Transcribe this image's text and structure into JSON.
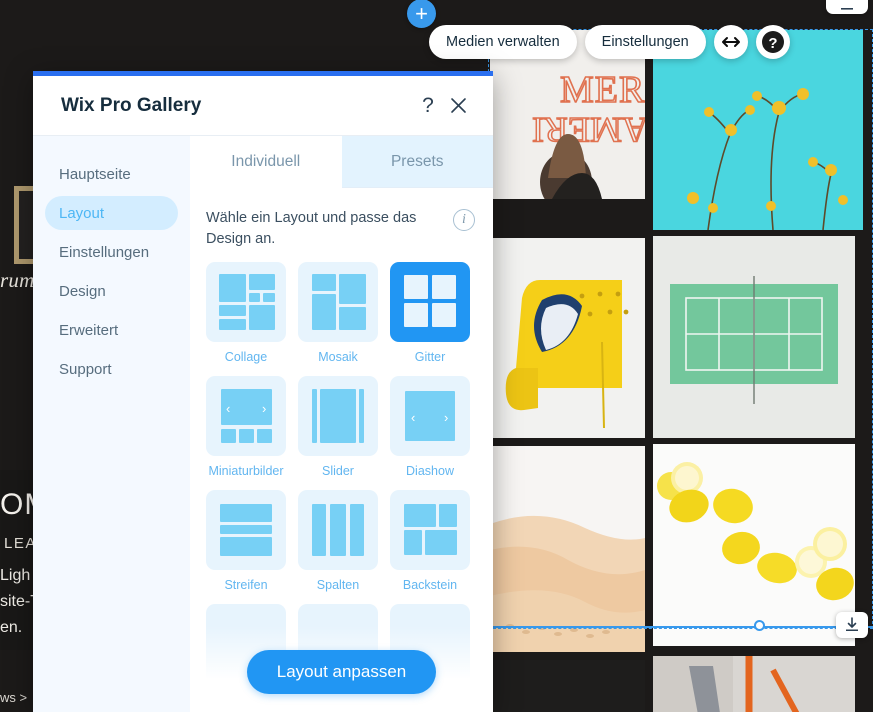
{
  "editor": {
    "add_button_label": "+",
    "toolbar": {
      "manage_media_label": "Medien verwalten",
      "settings_label": "Einstellungen",
      "stretch_icon": "arrows-horizontal-icon",
      "help_icon": "question-mark-circle-icon"
    },
    "top_right_button_icon": "minimize-icon",
    "download_button_icon": "download-icon",
    "left_site_text": {
      "word": "rum",
      "heading": "OM",
      "subheading": "LEAN",
      "line1": "Ligh",
      "line2": "site-T",
      "line3": "en.",
      "footer": "ws >"
    },
    "gallery_tiles": [
      {
        "name": "neon-america-sign-photo"
      },
      {
        "name": "yellow-flowers-teal-sky-photo"
      },
      {
        "name": "yellow-sofa-photo"
      },
      {
        "name": "green-tennis-court-photo"
      },
      {
        "name": "desert-dunes-photo"
      },
      {
        "name": "lemons-on-white-photo"
      },
      {
        "name": "dark-photo"
      },
      {
        "name": "bicycle-photo"
      }
    ]
  },
  "modal": {
    "title": "Wix Pro Gallery",
    "help_icon": "question-mark-icon",
    "close_icon": "close-x-icon",
    "sidebar": {
      "items": [
        {
          "label": "Hauptseite",
          "active": false
        },
        {
          "label": "Layout",
          "active": true
        },
        {
          "label": "Einstellungen",
          "active": false
        },
        {
          "label": "Design",
          "active": false
        },
        {
          "label": "Erweitert",
          "active": false
        },
        {
          "label": "Support",
          "active": false
        }
      ]
    },
    "tabs": [
      {
        "label": "Individuell",
        "active": true
      },
      {
        "label": "Presets",
        "active": false
      }
    ],
    "intro_text": "Wähle ein Layout und passe das Design an.",
    "info_icon": "info-circle-icon",
    "layouts": [
      {
        "label": "Collage",
        "selected": false,
        "pattern": "collage"
      },
      {
        "label": "Mosaik",
        "selected": false,
        "pattern": "mosaik"
      },
      {
        "label": "Gitter",
        "selected": true,
        "pattern": "gitter"
      },
      {
        "label": "Miniaturbilder",
        "selected": false,
        "pattern": "thumbs"
      },
      {
        "label": "Slider",
        "selected": false,
        "pattern": "slider"
      },
      {
        "label": "Diashow",
        "selected": false,
        "pattern": "diashow"
      },
      {
        "label": "Streifen",
        "selected": false,
        "pattern": "streifen"
      },
      {
        "label": "Spalten",
        "selected": false,
        "pattern": "spalten"
      },
      {
        "label": "Backstein",
        "selected": false,
        "pattern": "backstein"
      },
      {
        "label": "",
        "selected": false,
        "pattern": "empty"
      },
      {
        "label": "",
        "selected": false,
        "pattern": "empty"
      },
      {
        "label": "",
        "selected": false,
        "pattern": "empty"
      }
    ],
    "cta_label": "Layout anpassen"
  },
  "colors": {
    "accent": "#2196f3",
    "thumb_bg": "#e7f4fd",
    "thumb_block": "#77d0f5",
    "sidebar_bg": "#f4f9ff",
    "label_blue": "#62b6f0",
    "top_bar": "#2a6ff0"
  }
}
